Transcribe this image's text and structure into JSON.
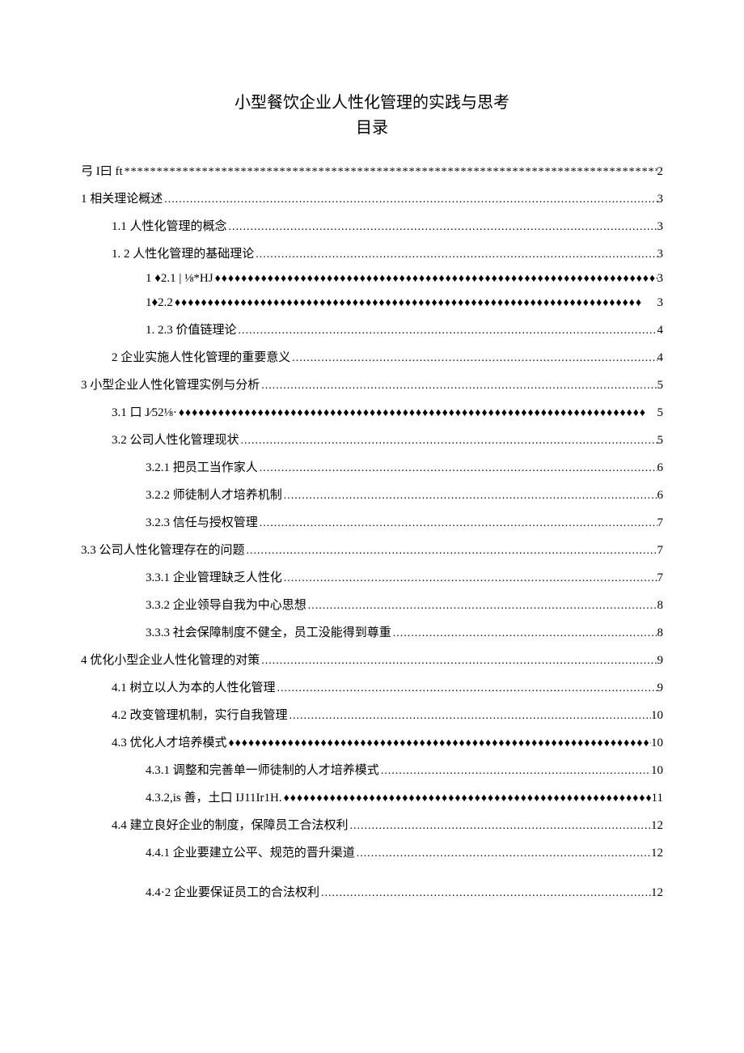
{
  "title": "小型餐饮企业人性化管理的实践与思考",
  "subtitle": "目录",
  "toc": [
    {
      "text": "弓 I曰 ft",
      "page": "2",
      "leader": "stars",
      "indent": 0
    },
    {
      "text": "1 相关理论概述 ",
      "page": "3",
      "leader": "dots",
      "indent": 0
    },
    {
      "text": "1.1 人性化管理的概念",
      "page": "3",
      "leader": "dots",
      "indent": 1
    },
    {
      "text": "1.  2 人性化管理的基础理论 ",
      "page": "3",
      "leader": "dots",
      "indent": 1
    },
    {
      "text": "1  ♦2.1    | ⅛*HJ",
      "page": "3",
      "leader": "diamonds",
      "indent": 2
    },
    {
      "text": "1♦2.2             ",
      "page": "3",
      "leader": "diamonds",
      "indent": 2
    },
    {
      "text": "1.  2.3 价值链理论",
      "page": "4",
      "leader": "dots",
      "indent": 2
    },
    {
      "text": "2 企业实施人性化管理的重要意义",
      "page": "4",
      "leader": "dots",
      "indent": 1
    },
    {
      "text": "3 小型企业人性化管理实例与分析 ",
      "page": "5",
      "leader": "dots",
      "indent": 0
    },
    {
      "text": "3.1 口 J∕52⅛·",
      "page": "5",
      "leader": "diamonds",
      "indent": 1
    },
    {
      "text": "3.2 公司人性化管理现状",
      "page": "5",
      "leader": "dots",
      "indent": 1
    },
    {
      "text": "3.2.1 把员工当作家人",
      "page": "6",
      "leader": "dots",
      "indent": 2
    },
    {
      "text": "3.2.2 师徒制人才培养机制",
      "page": "6",
      "leader": "dots",
      "indent": 2
    },
    {
      "text": "3.2.3 信任与授权管理",
      "page": "7",
      "leader": "dots",
      "indent": 2
    },
    {
      "text": "3.3 公司人性化管理存在的问题",
      "page": "7",
      "leader": "dots",
      "indent": 0
    },
    {
      "text": "3.3.1 企业管理缺乏人性化",
      "page": "7",
      "leader": "dots",
      "indent": 2
    },
    {
      "text": "3.3.2 企业领导自我为中心思想",
      "page": "8",
      "leader": "dots",
      "indent": 2
    },
    {
      "text": "3.3.3 社会保障制度不健全，员工没能得到尊重",
      "page": "8",
      "leader": "dots",
      "indent": 2
    },
    {
      "text": "4 优化小型企业人性化管理的对策 ",
      "page": "9",
      "leader": "dots",
      "indent": 0
    },
    {
      "text": "4.1 树立以人为本的人性化管理",
      "page": "9",
      "leader": "dots",
      "indent": 1
    },
    {
      "text": "4.2 改变管理机制，实行自我管理 ",
      "page": "10",
      "leader": "dots",
      "indent": 1
    },
    {
      "text": "4.3 优化人才培养模式",
      "page": "10",
      "leader": "diamonds",
      "indent": 1
    },
    {
      "text": "4.3.1 调整和完善单一师徒制的人才培养模式",
      "page": "10",
      "leader": "dots",
      "indent": 2
    },
    {
      "text": "4.3.2,is 善，土口 IJ11Ir1H.",
      "page": "11",
      "leader": "diamonds",
      "indent": 2
    },
    {
      "text": "4.4 建立良好企业的制度，保障员工合法权利 ",
      "page": "12",
      "leader": "dots",
      "indent": 1
    },
    {
      "text": "4.4.1 企业要建立公平、规范的晋升渠道",
      "page": "12",
      "leader": "dots",
      "indent": 2
    },
    {
      "text": "4.4·2 企业要保证员工的合法权利",
      "page": "12",
      "leader": "dots",
      "indent": 2,
      "gap": true
    }
  ]
}
